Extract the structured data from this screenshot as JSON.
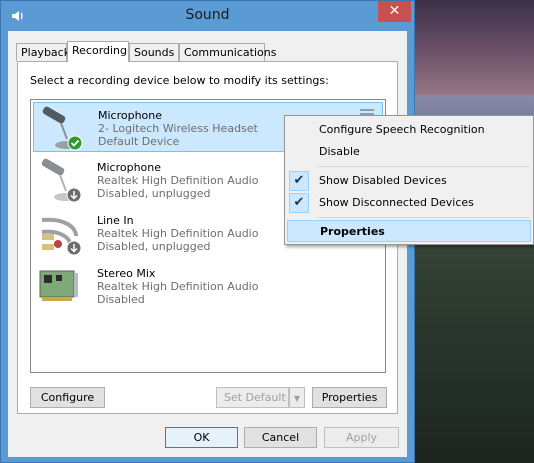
{
  "window": {
    "title": "Sound",
    "close_glyph": "✕"
  },
  "tabs": [
    {
      "label": "Playback"
    },
    {
      "label": "Recording"
    },
    {
      "label": "Sounds"
    },
    {
      "label": "Communications"
    }
  ],
  "instruction": "Select a recording device below to modify its settings:",
  "devices": [
    {
      "name": "Microphone",
      "line2": "2- Logitech Wireless Headset",
      "line3": "Default Device",
      "icon": "microphone-default-icon"
    },
    {
      "name": "Microphone",
      "line2": "Realtek High Definition Audio",
      "line3": "Disabled, unplugged",
      "icon": "microphone-icon"
    },
    {
      "name": "Line In",
      "line2": "Realtek High Definition Audio",
      "line3": "Disabled, unplugged",
      "icon": "line-in-icon"
    },
    {
      "name": "Stereo Mix",
      "line2": "Realtek High Definition Audio",
      "line3": "Disabled",
      "icon": "sound-card-icon"
    }
  ],
  "buttons": {
    "configure": "Configure",
    "set_default": "Set Default",
    "properties": "Properties",
    "ok": "OK",
    "cancel": "Cancel",
    "apply": "Apply"
  },
  "context_menu": {
    "items": [
      {
        "label": "Configure Speech Recognition",
        "checked": false
      },
      {
        "label": "Disable",
        "checked": false
      },
      {
        "label": "Show Disabled Devices",
        "checked": true
      },
      {
        "label": "Show Disconnected Devices",
        "checked": true
      },
      {
        "label": "Properties",
        "checked": false,
        "highlighted": true
      }
    ],
    "check_glyph": "✔"
  },
  "colors": {
    "titlebar": "#5b9bd5",
    "close_button": "#c75050",
    "selection": "#cce8ff"
  }
}
